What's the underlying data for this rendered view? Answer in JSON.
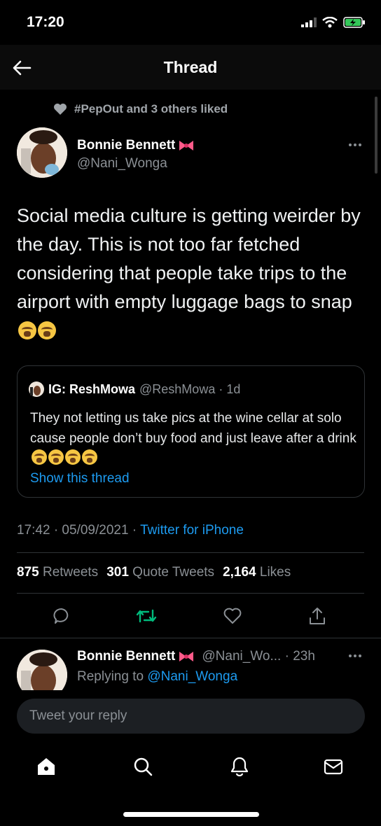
{
  "status": {
    "time": "17:20"
  },
  "header": {
    "title": "Thread"
  },
  "social_context": {
    "text": "#PepOut and 3 others liked"
  },
  "tweet": {
    "author_name": "Bonnie Bennett",
    "author_handle": "@Nani_Wonga",
    "text": "Social media culture is getting weirder by the day. This is not too far fetched considering that people take trips to the airport with empty luggage bags to snap",
    "timestamp": "17:42 · 05/09/2021 · ",
    "source": "Twitter for iPhone",
    "stats": {
      "retweets_count": "875",
      "retweets_label": "Retweets",
      "quotes_count": "301",
      "quotes_label": "Quote Tweets",
      "likes_count": "2,164",
      "likes_label": "Likes"
    }
  },
  "quote": {
    "name": "IG: ReshMowa",
    "handle": "@ReshMowa · 1d",
    "text": "They not letting us take pics at the wine cellar at solo cause people don’t buy food and just leave after a drink",
    "link": "Show this thread"
  },
  "reply": {
    "author_name": "Bonnie Bennett",
    "author_handle": "@Nani_Wo... · 23h",
    "replying_prefix": "Replying to ",
    "replying_to": "@Nani_Wonga"
  },
  "composer": {
    "placeholder": "Tweet your reply"
  },
  "colors": {
    "accent": "#1d9bf0",
    "retweet": "#00ba7c",
    "background": "#000000"
  },
  "icons": {
    "actions": [
      "reply-icon",
      "retweet-icon",
      "like-icon",
      "share-icon"
    ],
    "nav": [
      "home-icon",
      "search-icon",
      "notifications-icon",
      "messages-icon"
    ]
  }
}
